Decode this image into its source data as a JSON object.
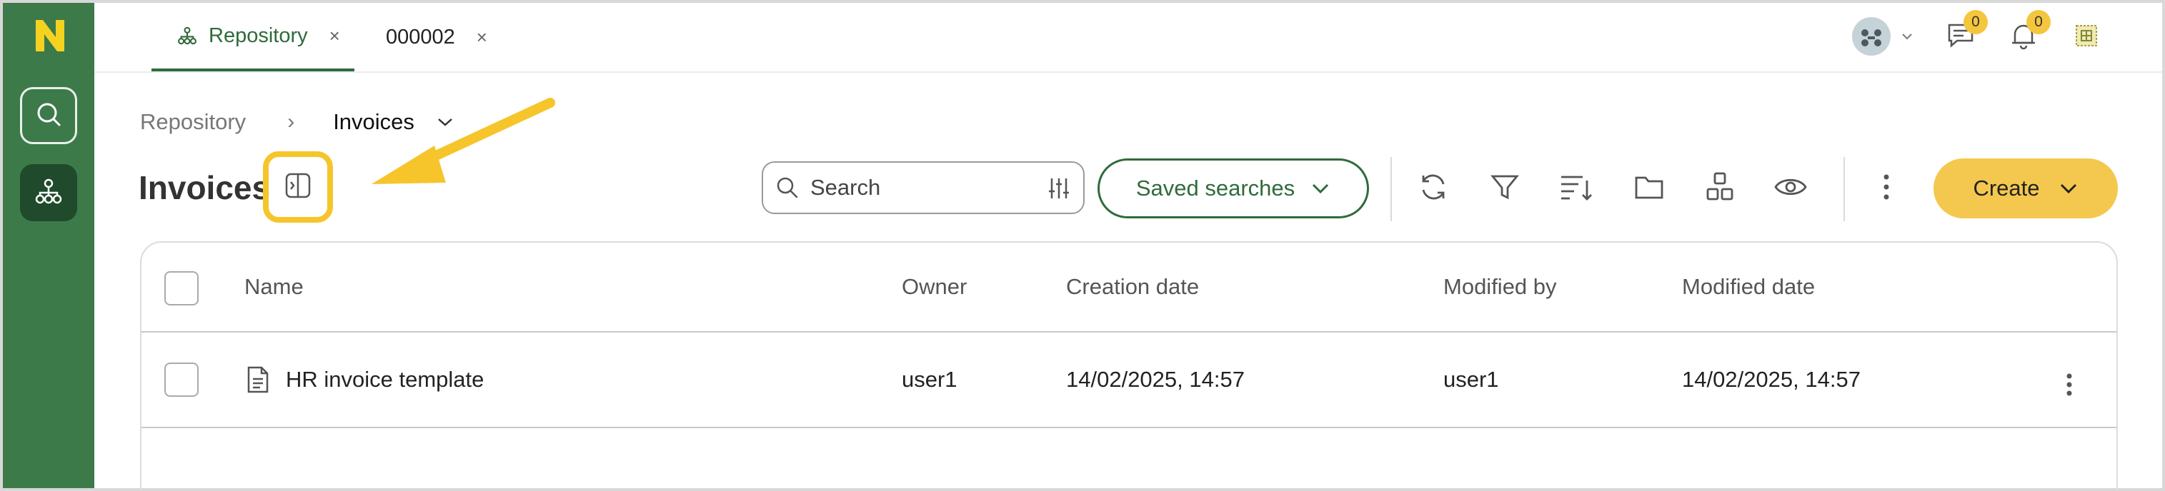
{
  "tabs": [
    {
      "label": "Repository",
      "active": true
    },
    {
      "label": "000002",
      "active": false
    }
  ],
  "tab_close_glyph": "×",
  "header": {
    "chat_badge": "0",
    "notifications_badge": "0"
  },
  "breadcrumb": {
    "items": [
      "Repository",
      "Invoices"
    ],
    "separator": "›"
  },
  "page_title": "Invoices",
  "search": {
    "placeholder": "Search"
  },
  "saved_searches_label": "Saved searches",
  "create_label": "Create",
  "table": {
    "columns": [
      "Name",
      "Owner",
      "Creation date",
      "Modified by",
      "Modified date"
    ],
    "rows": [
      {
        "name": "HR invoice template",
        "owner": "user1",
        "creation_date": "14/02/2025, 14:57",
        "modified_by": "user1",
        "modified_date": "14/02/2025, 14:57"
      }
    ]
  },
  "colors": {
    "brand_green": "#3d7a4a",
    "accent_yellow": "#f4c84e",
    "highlight_yellow": "#f6c52c"
  },
  "icons": [
    "logo-icon",
    "search-icon",
    "repository-icon",
    "close-icon",
    "avatar-icon",
    "chevron-down-icon",
    "chat-icon",
    "bell-icon",
    "apps-icon",
    "panel-toggle-icon",
    "filter-settings-icon",
    "refresh-icon",
    "funnel-icon",
    "sort-icon",
    "folder-icon",
    "layout-icon",
    "eye-icon",
    "more-vertical-icon",
    "document-icon"
  ]
}
